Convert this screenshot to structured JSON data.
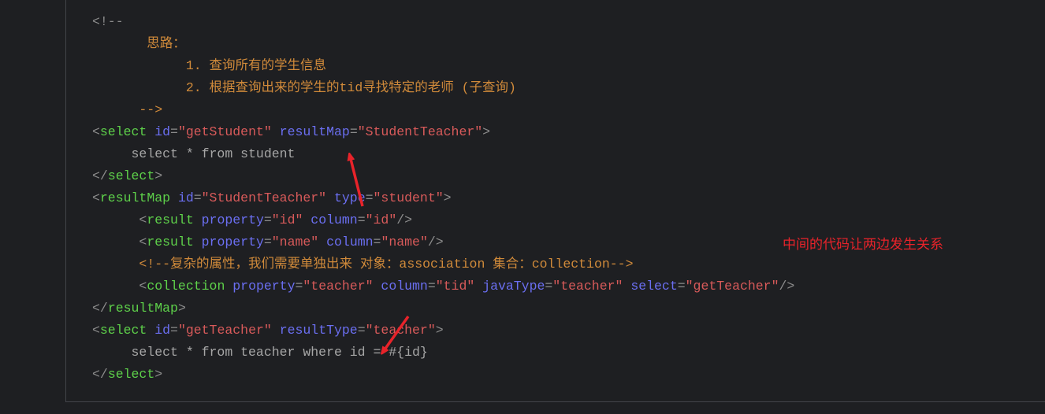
{
  "code_lines": [
    [
      [
        "br",
        "<!--"
      ]
    ],
    [
      [
        "cm",
        "       思路："
      ]
    ],
    [
      [
        "cm",
        "            1. 查询所有的学生信息"
      ]
    ],
    [
      [
        "cm",
        "            2. 根据查询出来的学生的tid寻找特定的老师 (子查询)"
      ]
    ],
    [
      [
        "cm",
        "      -->"
      ]
    ],
    [
      [
        "br",
        "<"
      ],
      [
        "tag",
        "select"
      ],
      [
        "txt",
        " "
      ],
      [
        "attr",
        "id"
      ],
      [
        "eq",
        "="
      ],
      [
        "val",
        "\"getStudent\""
      ],
      [
        "txt",
        " "
      ],
      [
        "attr",
        "resultMap"
      ],
      [
        "eq",
        "="
      ],
      [
        "val",
        "\"StudentTeacher\""
      ],
      [
        "br",
        ">"
      ]
    ],
    [
      [
        "txt",
        "     select * from student"
      ]
    ],
    [
      [
        "br",
        "</"
      ],
      [
        "tag",
        "select"
      ],
      [
        "br",
        ">"
      ]
    ],
    [
      [
        "br",
        "<"
      ],
      [
        "tag",
        "resultMap"
      ],
      [
        "txt",
        " "
      ],
      [
        "attr",
        "id"
      ],
      [
        "eq",
        "="
      ],
      [
        "val",
        "\"StudentTeacher\""
      ],
      [
        "txt",
        " "
      ],
      [
        "attr",
        "type"
      ],
      [
        "eq",
        "="
      ],
      [
        "val",
        "\"student\""
      ],
      [
        "br",
        ">"
      ]
    ],
    [
      [
        "txt",
        "      "
      ],
      [
        "br",
        "<"
      ],
      [
        "tag",
        "result"
      ],
      [
        "txt",
        " "
      ],
      [
        "attr",
        "property"
      ],
      [
        "eq",
        "="
      ],
      [
        "val",
        "\"id\""
      ],
      [
        "txt",
        " "
      ],
      [
        "attr",
        "column"
      ],
      [
        "eq",
        "="
      ],
      [
        "val",
        "\"id\""
      ],
      [
        "br",
        "/>"
      ]
    ],
    [
      [
        "txt",
        "      "
      ],
      [
        "br",
        "<"
      ],
      [
        "tag",
        "result"
      ],
      [
        "txt",
        " "
      ],
      [
        "attr",
        "property"
      ],
      [
        "eq",
        "="
      ],
      [
        "val",
        "\"name\""
      ],
      [
        "txt",
        " "
      ],
      [
        "attr",
        "column"
      ],
      [
        "eq",
        "="
      ],
      [
        "val",
        "\"name\""
      ],
      [
        "br",
        "/>"
      ]
    ],
    [
      [
        "txt",
        "      "
      ],
      [
        "cm",
        "<!--复杂的属性，我们需要单独出来 对象：association 集合：collection-->"
      ]
    ],
    [
      [
        "txt",
        "      "
      ],
      [
        "br",
        "<"
      ],
      [
        "tag",
        "collection"
      ],
      [
        "txt",
        " "
      ],
      [
        "attr",
        "property"
      ],
      [
        "eq",
        "="
      ],
      [
        "val",
        "\"teacher\""
      ],
      [
        "txt",
        " "
      ],
      [
        "attr",
        "column"
      ],
      [
        "eq",
        "="
      ],
      [
        "val",
        "\"tid\""
      ],
      [
        "txt",
        " "
      ],
      [
        "attr",
        "javaType"
      ],
      [
        "eq",
        "="
      ],
      [
        "val",
        "\"teacher\""
      ],
      [
        "txt",
        " "
      ],
      [
        "attr",
        "select"
      ],
      [
        "eq",
        "="
      ],
      [
        "val",
        "\"getTeacher\""
      ],
      [
        "br",
        "/>"
      ]
    ],
    [
      [
        "br",
        "</"
      ],
      [
        "tag",
        "resultMap"
      ],
      [
        "br",
        ">"
      ]
    ],
    [
      [
        "br",
        "<"
      ],
      [
        "tag",
        "select"
      ],
      [
        "txt",
        " "
      ],
      [
        "attr",
        "id"
      ],
      [
        "eq",
        "="
      ],
      [
        "val",
        "\"getTeacher\""
      ],
      [
        "txt",
        " "
      ],
      [
        "attr",
        "resultType"
      ],
      [
        "eq",
        "="
      ],
      [
        "val",
        "\"teacher\""
      ],
      [
        "br",
        ">"
      ]
    ],
    [
      [
        "txt",
        "     select * from teacher where id = #{id}"
      ]
    ],
    [
      [
        "br",
        "</"
      ],
      [
        "tag",
        "select"
      ],
      [
        "br",
        ">"
      ]
    ]
  ],
  "annotation": "中间的代码让两边发生关系",
  "colors": {
    "annotation": "#e8232a",
    "arrow": "#e8232a"
  }
}
